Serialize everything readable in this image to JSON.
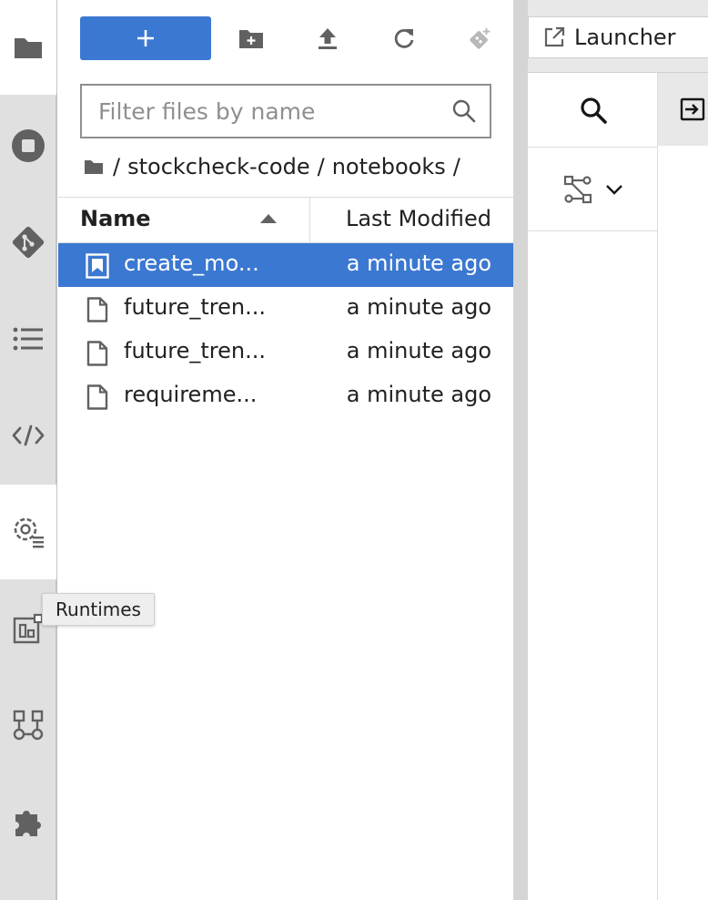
{
  "colors": {
    "accent": "#3b78d1",
    "icon_gray": "#616161",
    "activity_bg": "#e0e0e0"
  },
  "activity_bar": {
    "items": [
      {
        "name": "file-browser",
        "icon": "folder-icon"
      },
      {
        "name": "running-sessions",
        "icon": "stop-circle-icon"
      },
      {
        "name": "git",
        "icon": "git-icon"
      },
      {
        "name": "table-of-contents",
        "icon": "list-icon"
      },
      {
        "name": "code-snippets",
        "icon": "code-icon"
      },
      {
        "name": "runtimes",
        "icon": "gear-list-icon"
      },
      {
        "name": "runtime-images",
        "icon": "grid-icon"
      },
      {
        "name": "components",
        "icon": "pipeline-components-icon"
      },
      {
        "name": "extensions",
        "icon": "puzzle-icon"
      }
    ]
  },
  "tooltip": {
    "text": "Runtimes"
  },
  "file_browser": {
    "toolbar": {
      "new_label": "+",
      "icons": [
        "new-folder-icon",
        "upload-icon",
        "refresh-icon",
        "git-clone-icon"
      ]
    },
    "filter": {
      "placeholder": "Filter files by name",
      "value": ""
    },
    "breadcrumb": {
      "root": "/",
      "segments": [
        "stockcheck-code",
        "/",
        "notebooks",
        "/"
      ]
    },
    "columns": {
      "name": "Name",
      "last_modified": "Last Modified"
    },
    "files": [
      {
        "name": "create_mo...",
        "modified": "a minute ago",
        "icon": "notebook-icon",
        "selected": true
      },
      {
        "name": "future_tren...",
        "modified": "a minute ago",
        "icon": "file-icon",
        "selected": false
      },
      {
        "name": "future_tren...",
        "modified": "a minute ago",
        "icon": "file-icon",
        "selected": false
      },
      {
        "name": "requireme...",
        "modified": "a minute ago",
        "icon": "file-icon",
        "selected": false
      }
    ]
  },
  "main": {
    "tab": {
      "label": "Launcher",
      "icon": "launch-icon"
    }
  }
}
